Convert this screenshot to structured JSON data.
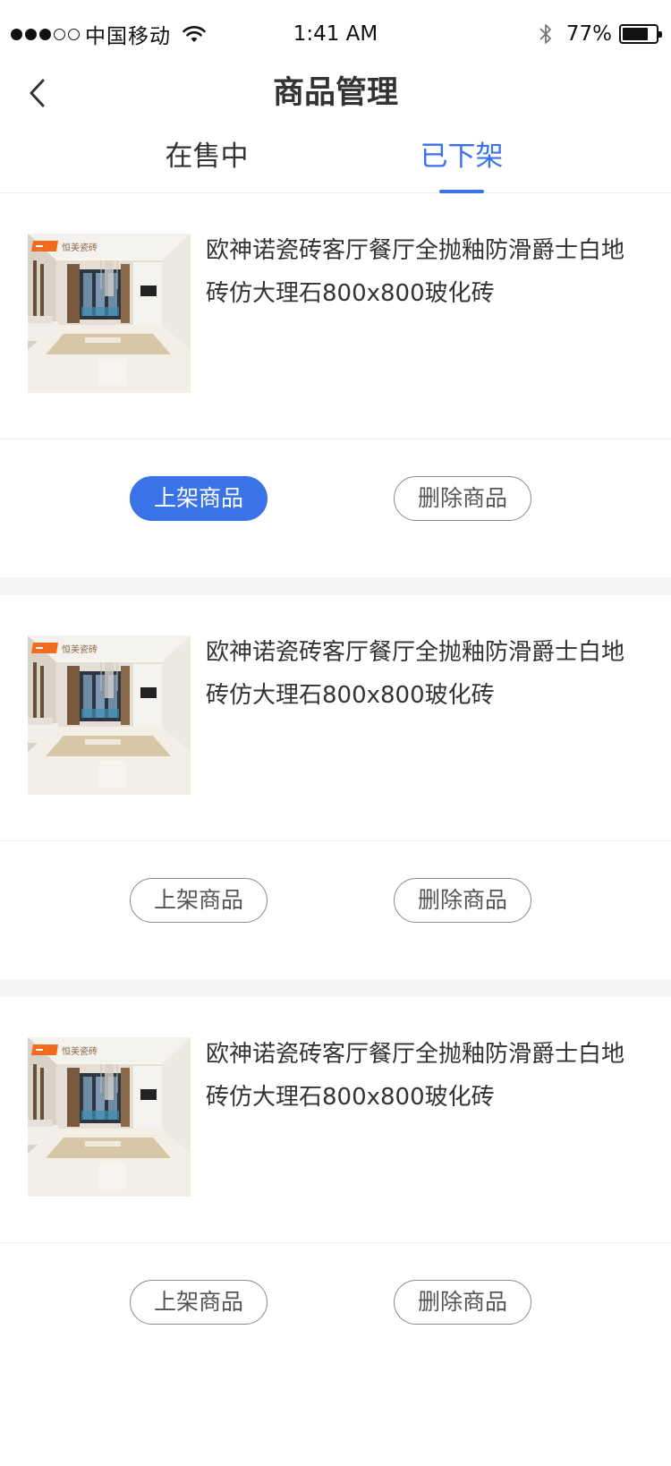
{
  "status_bar": {
    "carrier": "中国移动",
    "time": "1:41 AM",
    "battery_text": "77%",
    "battery_level": 0.77,
    "signal_bars_filled": 3,
    "signal_bars_total": 5,
    "icons": [
      "wifi-icon",
      "bluetooth-icon",
      "battery-icon"
    ]
  },
  "nav": {
    "title": "商品管理",
    "back_icon": "chevron-left-icon"
  },
  "tabs": [
    {
      "label": "在售中",
      "active": false
    },
    {
      "label": "已下架",
      "active": true
    }
  ],
  "colors": {
    "accent": "#3a72e8",
    "text": "#333333",
    "divider": "#eeeeee",
    "section_gap": "#f4f5f7"
  },
  "products": [
    {
      "title": "欧神诺瓷砖客厅餐厅全抛釉防滑爵士白地砖仿大理石800x800玻化砖",
      "image": "living-room-tile-photo",
      "logo_text": "恒美瓷砖",
      "actions": [
        {
          "label": "上架商品",
          "primary": true
        },
        {
          "label": "删除商品",
          "primary": false
        }
      ]
    },
    {
      "title": "欧神诺瓷砖客厅餐厅全抛釉防滑爵士白地砖仿大理石800x800玻化砖",
      "image": "living-room-tile-photo",
      "logo_text": "恒美瓷砖",
      "actions": [
        {
          "label": "上架商品",
          "primary": false
        },
        {
          "label": "删除商品",
          "primary": false
        }
      ]
    },
    {
      "title": "欧神诺瓷砖客厅餐厅全抛釉防滑爵士白地砖仿大理石800x800玻化砖",
      "image": "living-room-tile-photo",
      "logo_text": "恒美瓷砖",
      "actions": [
        {
          "label": "上架商品",
          "primary": false
        },
        {
          "label": "删除商品",
          "primary": false
        }
      ]
    }
  ]
}
